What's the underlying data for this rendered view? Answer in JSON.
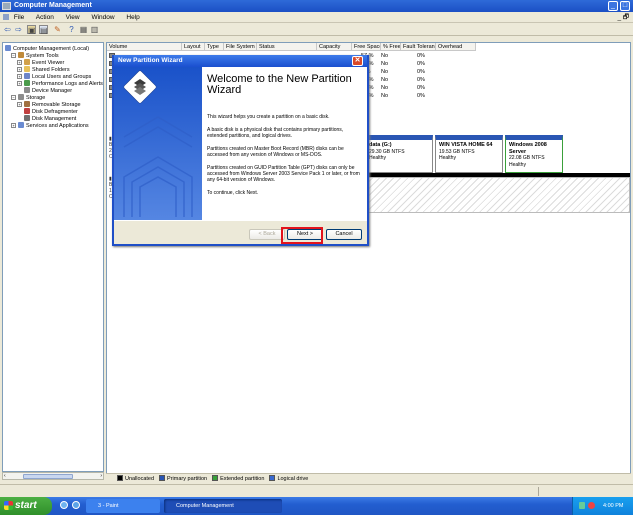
{
  "window": {
    "title": "Computer Management",
    "min_label": "_",
    "max_label": "□"
  },
  "menu": [
    "File",
    "Action",
    "View",
    "Window",
    "Help"
  ],
  "menu_right_controls": "_ 🗗",
  "tree": {
    "items": [
      {
        "label": "Computer Management (Local)",
        "indent": 0,
        "icon": "computer-icon",
        "color": "#6a8bd1"
      },
      {
        "label": "System Tools",
        "indent": 1,
        "icon": "tools-icon",
        "color": "#c08a3a"
      },
      {
        "label": "Event Viewer",
        "indent": 2,
        "icon": "event-viewer-icon",
        "color": "#d2a14a"
      },
      {
        "label": "Shared Folders",
        "indent": 2,
        "icon": "folder-icon",
        "color": "#e7c15a"
      },
      {
        "label": "Local Users and Groups",
        "indent": 2,
        "icon": "users-icon",
        "color": "#6f86c8"
      },
      {
        "label": "Performance Logs and Alerts",
        "indent": 2,
        "icon": "performance-icon",
        "color": "#4b9b4b"
      },
      {
        "label": "Device Manager",
        "indent": 2,
        "icon": "device-manager-icon",
        "color": "#8c8c8c"
      },
      {
        "label": "Storage",
        "indent": 1,
        "icon": "storage-icon",
        "color": "#8c8c8c"
      },
      {
        "label": "Removable Storage",
        "indent": 2,
        "icon": "removable-storage-icon",
        "color": "#a07040"
      },
      {
        "label": "Disk Defragmenter",
        "indent": 2,
        "icon": "defrag-icon",
        "color": "#c04040"
      },
      {
        "label": "Disk Management",
        "indent": 2,
        "icon": "disk-management-icon",
        "color": "#707070"
      },
      {
        "label": "Services and Applications",
        "indent": 1,
        "icon": "services-icon",
        "color": "#6a8bd1"
      }
    ]
  },
  "volume_table": {
    "columns": [
      "Volume",
      "Layout",
      "Type",
      "File System",
      "Status",
      "Capacity",
      "Free Space",
      "% Free",
      "Fault Tolerance",
      "Overhead"
    ],
    "rows": [
      {
        "pct_free": "57 %",
        "fault": "No",
        "overhead": "0%"
      },
      {
        "pct_free": "57 %",
        "fault": "No",
        "overhead": "0%"
      },
      {
        "pct_free": "9 %",
        "fault": "No",
        "overhead": "0%"
      },
      {
        "pct_free": "49 %",
        "fault": "No",
        "overhead": "0%"
      },
      {
        "pct_free": "85 %",
        "fault": "No",
        "overhead": "0%"
      },
      {
        "pct_free": "70 %",
        "fault": "No",
        "overhead": "0%"
      }
    ]
  },
  "partitions": [
    {
      "name": "data (G:)",
      "size": "29.30 GB NTFS",
      "status": "Healthy"
    },
    {
      "name": "WIN VISTA HOME 64",
      "size": "19.53 GB NTFS",
      "status": "Healthy"
    },
    {
      "name": "Windows 2008 Server",
      "size": "22.08 GB NTFS",
      "status": "Healthy"
    }
  ],
  "legend": [
    {
      "label": "Unallocated",
      "color": "#000000"
    },
    {
      "label": "Primary partition",
      "color": "#2a56b4"
    },
    {
      "label": "Extended partition",
      "color": "#3aa03a"
    },
    {
      "label": "Logical drive",
      "color": "#3a6ad0"
    }
  ],
  "wizard": {
    "title": "New Partition Wizard",
    "close_label": "✕",
    "heading": "Welcome to the New Partition Wizard",
    "paragraphs": [
      "This wizard helps you create a partition on a basic disk.",
      "A basic disk is a physical disk that contains primary partitions, extended partitions, and logical drives.",
      "Partitions created on Master Boot Record (MBR) disks can be accessed from any version of Windows or MS-DOS.",
      "Partitions created on GUID Partition Table (GPT) disks can only be accessed from Windows Server 2003 Service Pack 1 or later, or from any 64-bit version of Windows.",
      "To continue, click Next."
    ],
    "back_label": "< Back",
    "next_label": "Next >",
    "cancel_label": "Cancel"
  },
  "taskbar": {
    "start_label": "start",
    "tasks": [
      "3 - Paint",
      "Computer Management"
    ],
    "clock": "4:00 PM"
  }
}
